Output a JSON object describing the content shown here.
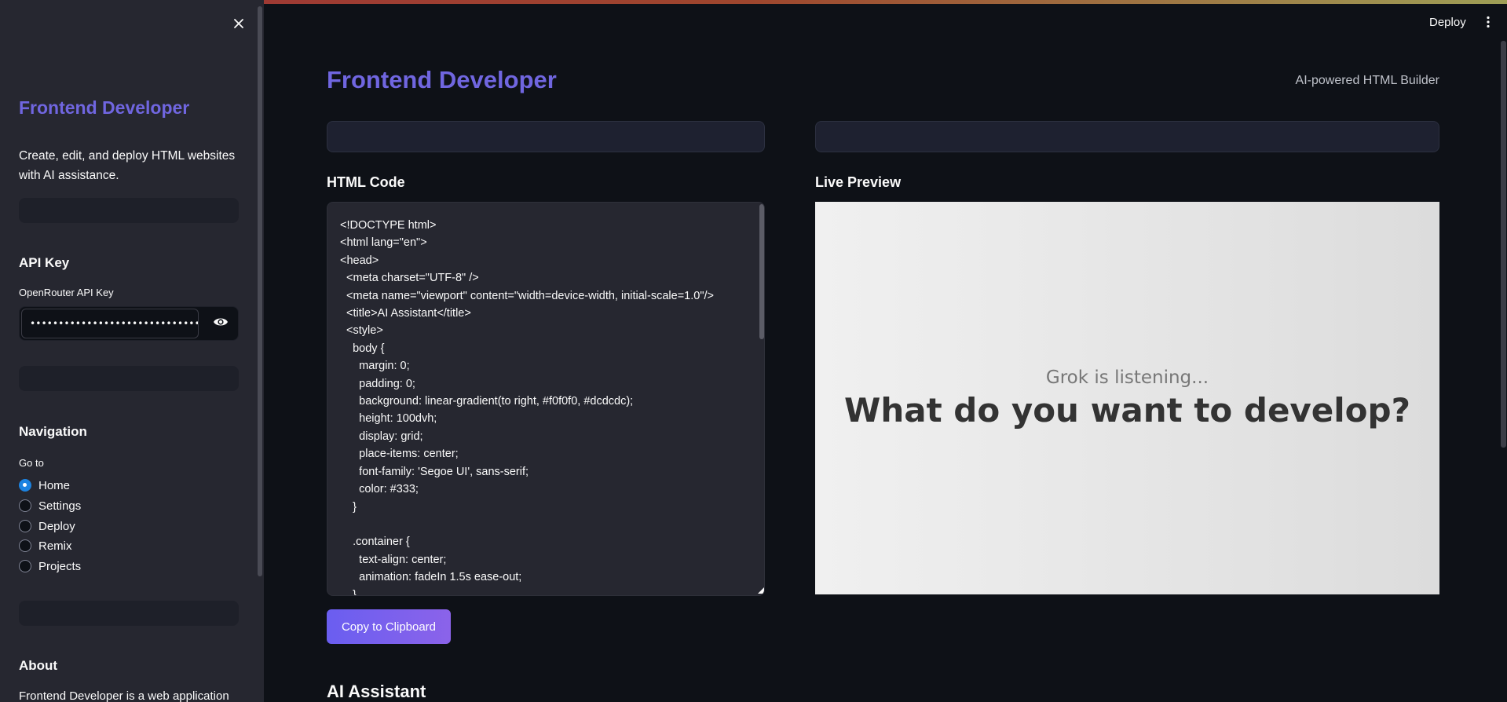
{
  "header": {
    "deploy_label": "Deploy"
  },
  "sidebar": {
    "title": "Frontend Developer",
    "description": "Create, edit, and deploy HTML websites with AI assistance.",
    "api_heading": "API Key",
    "api_label": "OpenRouter API Key",
    "api_value": "••••••••••••••••••••••••••••••••••••••••",
    "nav_heading": "Navigation",
    "nav_label": "Go to",
    "nav_items": [
      {
        "label": "Home",
        "checked": true
      },
      {
        "label": "Settings",
        "checked": false
      },
      {
        "label": "Deploy",
        "checked": false
      },
      {
        "label": "Remix",
        "checked": false
      },
      {
        "label": "Projects",
        "checked": false
      }
    ],
    "about_heading": "About",
    "about_text": "Frontend Developer is a web application"
  },
  "main": {
    "title": "Frontend Developer",
    "subtitle": "AI-powered HTML Builder",
    "code_label": "HTML Code",
    "preview_label": "Live Preview",
    "code": "<!DOCTYPE html>\n<html lang=\"en\">\n<head>\n  <meta charset=\"UTF-8\" />\n  <meta name=\"viewport\" content=\"width=device-width, initial-scale=1.0\"/>\n  <title>AI Assistant</title>\n  <style>\n    body {\n      margin: 0;\n      padding: 0;\n      background: linear-gradient(to right, #f0f0f0, #dcdcdc);\n      height: 100dvh;\n      display: grid;\n      place-items: center;\n      font-family: 'Segoe UI', sans-serif;\n      color: #333;\n    }\n\n    .container {\n      text-align: center;\n      animation: fadeIn 1.5s ease-out;\n    }",
    "preview": {
      "subtitle": "Grok is listening...",
      "headline": "What do you want to develop?"
    },
    "copy_label": "Copy to Clipboard",
    "ai_title": "AI Assistant"
  },
  "colors": {
    "accent": "#7066e0",
    "background": "#0e1117",
    "sidebar": "#262730",
    "radio_selected": "#1c83e1"
  }
}
